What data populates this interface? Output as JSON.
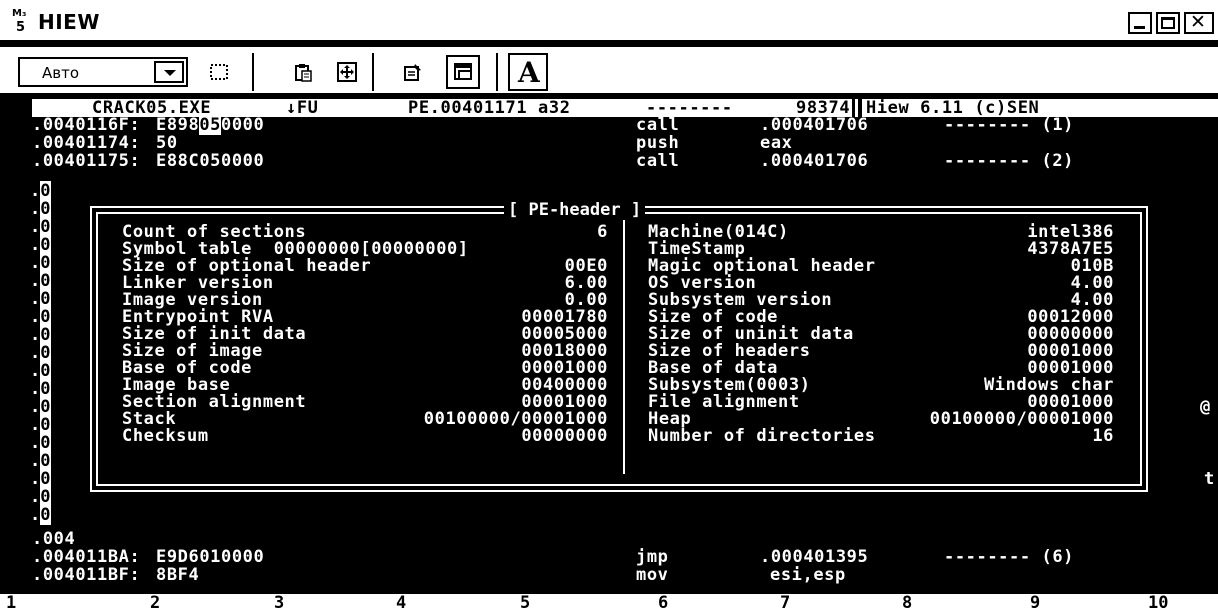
{
  "window": {
    "title": "HIEW",
    "icon_label": "M₃",
    "icon_sub": "5"
  },
  "toolbar": {
    "font_select_value": "Авто",
    "bold_a_label": "A"
  },
  "header": {
    "filename": "CRACK05.EXE",
    "mode": "↓FU",
    "address": "PE.00401171 a32",
    "dashes": "--------",
    "size": "98374",
    "version": "Hiew 6.11 (c)SEN"
  },
  "disasm": {
    "lines_top": [
      {
        "addr": ".0040116F:",
        "bytes_pre": "E898",
        "bytes_cur": "05",
        "bytes_post": "0000",
        "mnem": "call",
        "oper": ".000401706",
        "comment": "-------- (1)"
      },
      {
        "addr": ".00401174:",
        "bytes": "50",
        "mnem": "push",
        "oper": "eax",
        "comment": ""
      },
      {
        "addr": ".00401175:",
        "bytes": "E88C050000",
        "mnem": "call",
        "oper": ".000401706",
        "comment": "-------- (2)"
      }
    ],
    "line_partial": ".004",
    "lines_bottom": [
      {
        "addr": ".004011BA:",
        "bytes": "E9D6010000",
        "mnem": "jmp",
        "oper": ".000401395",
        "comment": "-------- (6)"
      },
      {
        "addr": ".004011BF:",
        "bytes": "8BF4",
        "mnem": "mov",
        "oper": "esi,esp",
        "comment": ""
      }
    ],
    "left_gutter": ".0",
    "left_gutter_zero": "0",
    "right_edge_chars": {
      "row8": "@",
      "row12": "t"
    }
  },
  "pe_header": {
    "title": "[ PE-header ]",
    "left": [
      {
        "label": "Count of sections",
        "value": "6"
      },
      {
        "label": "Symbol table  00000000[00000000]",
        "value": ""
      },
      {
        "label": "Size of optional header",
        "value": "00E0"
      },
      {
        "label": "Linker version",
        "value": "6.00"
      },
      {
        "label": "Image version",
        "value": "0.00"
      },
      {
        "label": "Entrypoint RVA",
        "value": "00001780"
      },
      {
        "label": "Size of init data",
        "value": "00005000"
      },
      {
        "label": "Size of image",
        "value": "00018000"
      },
      {
        "label": "Base of code",
        "value": "00001000"
      },
      {
        "label": "Image base",
        "value": "00400000"
      },
      {
        "label": "Section alignment",
        "value": "00001000"
      },
      {
        "label": "Stack",
        "value": "00100000/00001000"
      },
      {
        "label": "Checksum",
        "value": "00000000"
      }
    ],
    "right": [
      {
        "label": "Machine(014C)",
        "value": "intel386"
      },
      {
        "label": "TimeStamp",
        "value": "4378A7E5"
      },
      {
        "label": "Magic optional header",
        "value": "010B"
      },
      {
        "label": "OS version",
        "value": "4.00"
      },
      {
        "label": "Subsystem version",
        "value": "4.00"
      },
      {
        "label": "Size of code",
        "value": "00012000"
      },
      {
        "label": "Size of uninit data",
        "value": "00000000"
      },
      {
        "label": "Size of headers",
        "value": "00001000"
      },
      {
        "label": "Base of data",
        "value": "00001000"
      },
      {
        "label": "Subsystem(0003)",
        "value": "Windows char"
      },
      {
        "label": "File alignment",
        "value": "00001000"
      },
      {
        "label": "Heap",
        "value": "00100000/00001000"
      },
      {
        "label": "Number of directories",
        "value": "16"
      }
    ]
  },
  "fkeys": [
    "1",
    "2",
    "3",
    "4",
    "5",
    "6",
    "7",
    "8",
    "9",
    "10"
  ]
}
